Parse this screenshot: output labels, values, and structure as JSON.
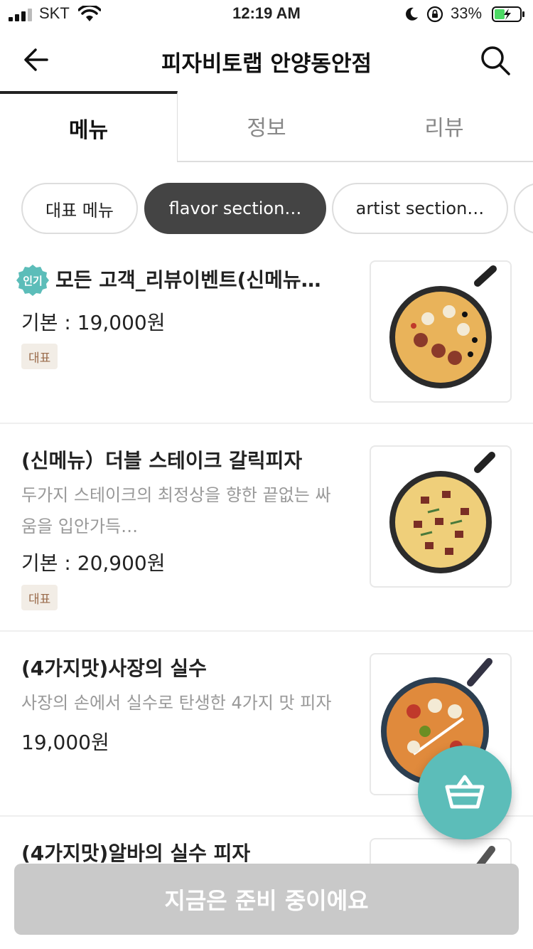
{
  "status_bar": {
    "carrier": "SKT",
    "time": "12:19 AM",
    "battery_pct": "33%",
    "icons": [
      "signal-icon",
      "wifi-icon",
      "moon-icon",
      "rotation-lock-icon",
      "battery-charging-icon"
    ]
  },
  "header": {
    "title": "피자비토랩 안양동안점",
    "back_icon": "arrow-left-icon",
    "search_icon": "search-icon"
  },
  "tabs": [
    {
      "label": "메뉴",
      "active": true
    },
    {
      "label": "정보",
      "active": false
    },
    {
      "label": "리뷰",
      "active": false
    }
  ],
  "chips": [
    {
      "label": "대표 메뉴",
      "active": false
    },
    {
      "label": "flavor section…",
      "active": true
    },
    {
      "label": "artist section…",
      "active": false
    },
    {
      "label": "",
      "active": false
    }
  ],
  "menu_items": [
    {
      "popular_badge": "인기",
      "name": "모든 고객_리뷰이벤트(신메뉴…",
      "description": "",
      "price": "기본 : 19,000원",
      "rep_badge": "대표"
    },
    {
      "name": "(신메뉴）더블 스테이크 갈릭피자",
      "description": "두가지 스테이크의 최정상을 향한 끝없는 싸움을 입안가득…",
      "price": "기본 : 20,900원",
      "rep_badge": "대표"
    },
    {
      "name": "(4가지맛)사장의 실수",
      "description": "사장의 손에서 실수로 탄생한 4가지 맛 피자",
      "price": "19,000원"
    },
    {
      "name": "(4가지맛)알바의 실수 피자"
    }
  ],
  "cart": {
    "icon": "shopping-basket-icon"
  },
  "order_button": {
    "label": "지금은 준비 중이에요"
  },
  "colors": {
    "accent": "#5cbdb9",
    "active_chip": "#444444",
    "disabled_button": "#c9c9c9",
    "badge_bg": "#f2ede6",
    "badge_text": "#9a6b4b"
  }
}
